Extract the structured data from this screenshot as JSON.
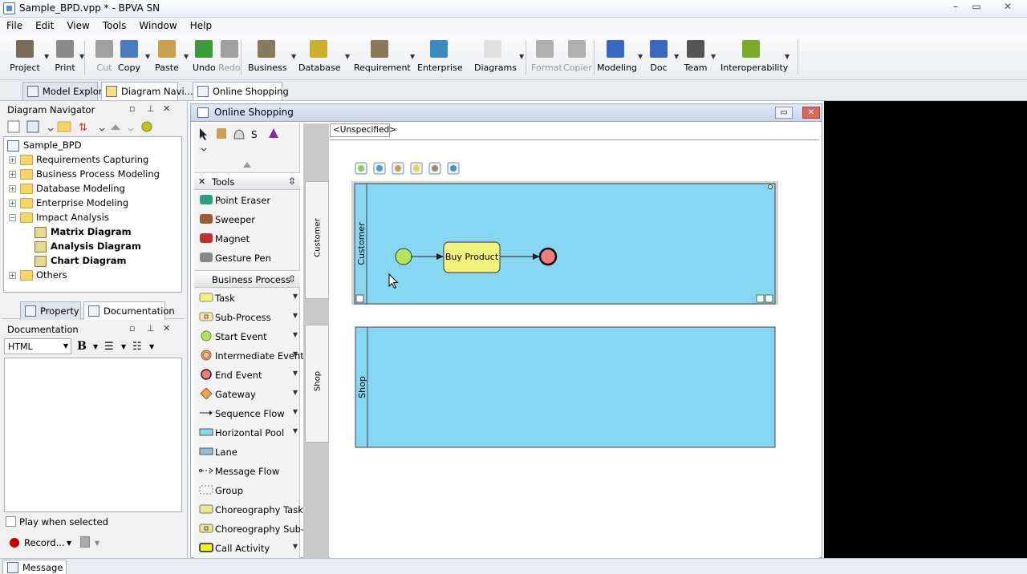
{
  "window": {
    "title": "Sample_BPD.vpp * - BPVA SN",
    "min": "–",
    "max": "▭",
    "close": "✕"
  },
  "menu": [
    "File",
    "Edit",
    "View",
    "Tools",
    "Window",
    "Help"
  ],
  "toolbar": {
    "items": [
      {
        "label": "Project",
        "icon": "project-icon",
        "color": "#7a6a5a"
      },
      {
        "label": "Print",
        "icon": "print-icon",
        "color": "#8a8a8a"
      },
      {
        "label": "Cut",
        "icon": "cut-icon",
        "color": "#a0a0a0",
        "disabled": true
      },
      {
        "label": "Copy",
        "icon": "copy-icon",
        "color": "#4a7ac0"
      },
      {
        "label": "Paste",
        "icon": "paste-icon",
        "color": "#c8a050"
      },
      {
        "label": "Undo",
        "icon": "undo-icon",
        "color": "#3a9a3a"
      },
      {
        "label": "Redo",
        "icon": "redo-icon",
        "color": "#a0a0a0",
        "disabled": true
      },
      {
        "label": "Business",
        "icon": "business-icon",
        "color": "#8a7a5a"
      },
      {
        "label": "Database",
        "icon": "database-icon",
        "color": "#c8b030"
      },
      {
        "label": "Requirement",
        "icon": "requirement-icon",
        "color": "#8a7a5a"
      },
      {
        "label": "Enterprise",
        "icon": "enterprise-icon",
        "color": "#3a8ac0"
      },
      {
        "label": "Diagrams",
        "icon": "diagrams-icon",
        "color": "#e0e0e0"
      },
      {
        "label": "Format",
        "icon": "format-icon",
        "color": "#b0b0b0",
        "disabled": true
      },
      {
        "label": "Copier",
        "icon": "copier-icon",
        "color": "#b0b0b0",
        "disabled": true
      },
      {
        "label": "Modeling",
        "icon": "modeling-icon",
        "color": "#3a6ac0"
      },
      {
        "label": "Doc",
        "icon": "doc-icon",
        "color": "#3a6ac0"
      },
      {
        "label": "Team",
        "icon": "team-icon",
        "color": "#555555"
      },
      {
        "label": "Interoperability",
        "icon": "interoperability-icon",
        "color": "#7aaa2a"
      }
    ]
  },
  "tabs": {
    "left": [
      {
        "label": "Model Explore"
      },
      {
        "label": "Diagram Navi..."
      }
    ],
    "main": [
      {
        "label": "Online Shopping"
      }
    ]
  },
  "navigator": {
    "title": "Diagram Navigator",
    "tree": [
      {
        "label": "Sample_BPD",
        "level": 0,
        "type": "root"
      },
      {
        "label": "Requirements Capturing",
        "level": 1,
        "type": "folder",
        "expander": "+"
      },
      {
        "label": "Business Process Modeling",
        "level": 1,
        "type": "folder",
        "expander": "+"
      },
      {
        "label": "Database Modeling",
        "level": 1,
        "type": "folder",
        "expander": "+"
      },
      {
        "label": "Enterprise Modeling",
        "level": 1,
        "type": "folder",
        "expander": "+"
      },
      {
        "label": "Impact Analysis",
        "level": 1,
        "type": "folder",
        "expander": "−"
      },
      {
        "label": "Matrix Diagram",
        "level": 2,
        "type": "diagram",
        "bold": true
      },
      {
        "label": "Analysis Diagram",
        "level": 2,
        "type": "diagram",
        "bold": true
      },
      {
        "label": "Chart Diagram",
        "level": 2,
        "type": "diagram",
        "bold": true
      },
      {
        "label": "Others",
        "level": 1,
        "type": "folder",
        "expander": "+"
      }
    ]
  },
  "bottomtabs": [
    {
      "label": "Property"
    },
    {
      "label": "Documentation"
    }
  ],
  "documentation": {
    "title": "Documentation",
    "format": "HTML",
    "bold": "B",
    "play_label": "Play when selected",
    "record_label": "Record..."
  },
  "diagram": {
    "title": "Online Shopping",
    "breadcrumb": "<Unspecified>",
    "palette": {
      "tools_header": "Tools",
      "tools": [
        {
          "label": "Point Eraser",
          "color": "#2aa080"
        },
        {
          "label": "Sweeper",
          "color": "#a05a30"
        },
        {
          "label": "Magnet",
          "color": "#c03030"
        },
        {
          "label": "Gesture Pen",
          "color": "#888888"
        }
      ],
      "bp_header": "Business Process",
      "bp": [
        {
          "label": "Task",
          "shape": "task",
          "arrow": true
        },
        {
          "label": "Sub-Process",
          "shape": "subprocess",
          "arrow": true
        },
        {
          "label": "Start Event",
          "shape": "start",
          "arrow": true
        },
        {
          "label": "Intermediate Event",
          "shape": "intermediate",
          "arrow": true
        },
        {
          "label": "End Event",
          "shape": "end",
          "arrow": true
        },
        {
          "label": "Gateway",
          "shape": "gateway",
          "arrow": true
        },
        {
          "label": "Sequence Flow",
          "shape": "seqflow",
          "arrow": true
        },
        {
          "label": "Horizontal Pool",
          "shape": "pool",
          "arrow": true
        },
        {
          "label": "Lane",
          "shape": "lane",
          "arrow": false
        },
        {
          "label": "Message Flow",
          "shape": "msgflow",
          "arrow": false
        },
        {
          "label": "Group",
          "shape": "group",
          "arrow": false
        },
        {
          "label": "Choreography Task",
          "shape": "chortask",
          "arrow": false
        },
        {
          "label": "Choreography Sub-Pr",
          "shape": "chorsub",
          "arrow": false
        },
        {
          "label": "Call Activity",
          "shape": "callact",
          "arrow": true
        }
      ]
    },
    "lanes": [
      "Customer",
      "Shop"
    ],
    "pools": [
      {
        "name": "Customer",
        "task": "Buy Product"
      },
      {
        "name": "Shop"
      }
    ],
    "colors": {
      "pool": "#87d7f2",
      "task": "#f1f47c",
      "start": "#b4e35e",
      "end": "#f07c7c"
    }
  },
  "status": {
    "message_tab": "Message"
  }
}
